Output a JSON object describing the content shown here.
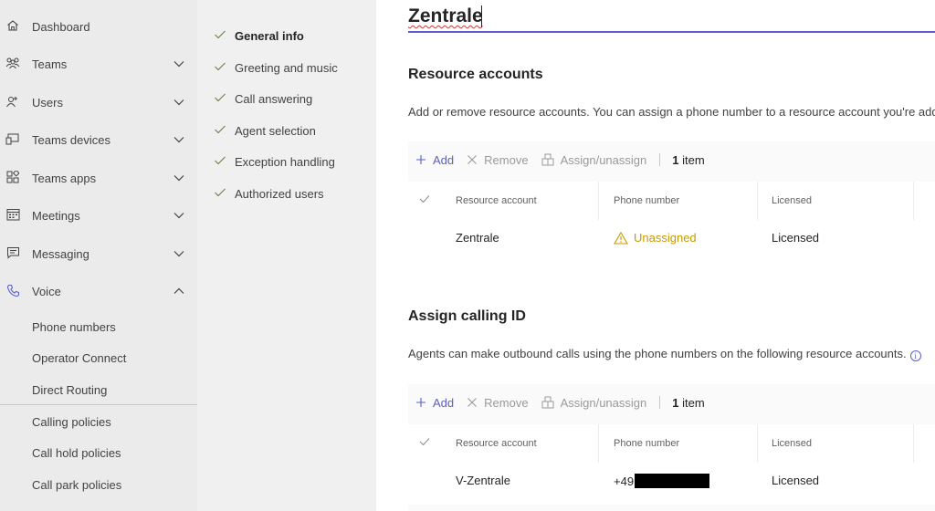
{
  "nav": {
    "items": [
      {
        "label": "Dashboard",
        "icon": "home-icon",
        "expandable": false
      },
      {
        "label": "Teams",
        "icon": "teams-icon",
        "expandable": true,
        "expanded": false
      },
      {
        "label": "Users",
        "icon": "users-icon",
        "expandable": true,
        "expanded": false
      },
      {
        "label": "Teams devices",
        "icon": "devices-icon",
        "expandable": true,
        "expanded": false
      },
      {
        "label": "Teams apps",
        "icon": "apps-icon",
        "expandable": true,
        "expanded": false
      },
      {
        "label": "Meetings",
        "icon": "calendar-icon",
        "expandable": true,
        "expanded": false
      },
      {
        "label": "Messaging",
        "icon": "chat-icon",
        "expandable": true,
        "expanded": false
      },
      {
        "label": "Voice",
        "icon": "phone-icon",
        "expandable": true,
        "expanded": true
      }
    ],
    "voice_sub": [
      "Phone numbers",
      "Operator Connect",
      "Direct Routing",
      "Calling policies",
      "Call hold policies",
      "Call park policies"
    ]
  },
  "steps": [
    {
      "label": "General info",
      "active": true
    },
    {
      "label": "Greeting and music",
      "active": false
    },
    {
      "label": "Call answering",
      "active": false
    },
    {
      "label": "Agent selection",
      "active": false
    },
    {
      "label": "Exception handling",
      "active": false
    },
    {
      "label": "Authorized users",
      "active": false
    }
  ],
  "main": {
    "name_value": "Zentrale",
    "resource_accounts": {
      "title": "Resource accounts",
      "description": "Add or remove resource accounts. You can assign a phone number to a resource account you're adding.",
      "toolbar": {
        "add": "Add",
        "remove": "Remove",
        "assign": "Assign/unassign",
        "count_num": "1",
        "count_unit": "item"
      },
      "columns": [
        "Resource account",
        "Phone number",
        "Licensed"
      ],
      "rows": [
        {
          "account": "Zentrale",
          "phone": "Unassigned",
          "licensed": "Licensed"
        }
      ]
    },
    "calling_id": {
      "title": "Assign calling ID",
      "description": "Agents can make outbound calls using the phone numbers on the following resource accounts.",
      "toolbar": {
        "add": "Add",
        "remove": "Remove",
        "assign": "Assign/unassign",
        "count_num": "1",
        "count_unit": "item"
      },
      "columns": [
        "Resource account",
        "Phone number",
        "Licensed"
      ],
      "rows": [
        {
          "account": "V-Zentrale",
          "phone_prefix": "+49",
          "licensed": "Licensed"
        }
      ]
    }
  },
  "colors": {
    "accent": "#5b5fc7",
    "warning": "#c79b00",
    "nav_bg": "#ebebeb"
  }
}
